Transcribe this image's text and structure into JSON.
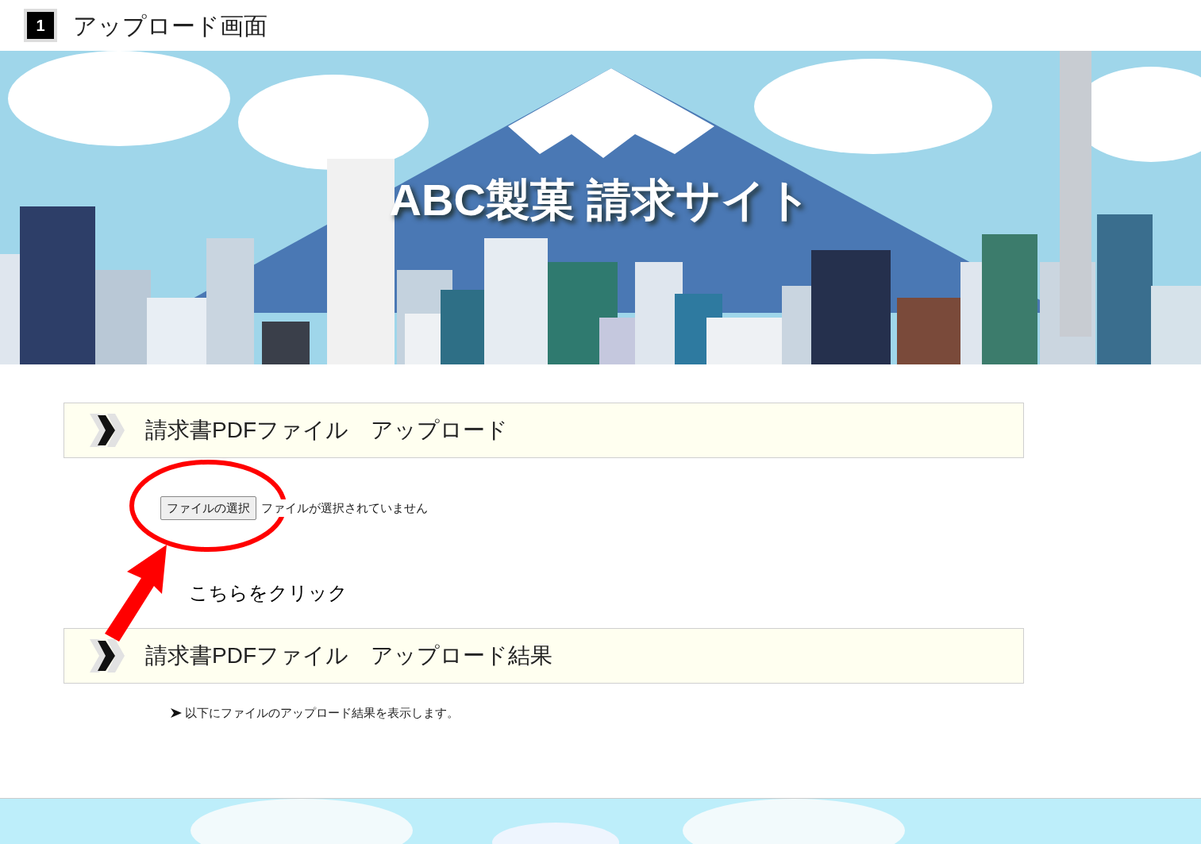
{
  "page_header": {
    "number": "1",
    "title": "アップロード画面"
  },
  "banner": {
    "title": "ABC製菓 請求サイト"
  },
  "sections": [
    {
      "kind": "upload",
      "title": "請求書PDFファイル　アップロード",
      "file_button": "ファイルの選択",
      "file_status": "ファイルが選択されていません"
    },
    {
      "kind": "result",
      "title": "請求書PDFファイル　アップロード結果",
      "note": "以下にファイルのアップロード結果を表示します。"
    }
  ],
  "annotation": {
    "text": "こちらをクリック"
  }
}
